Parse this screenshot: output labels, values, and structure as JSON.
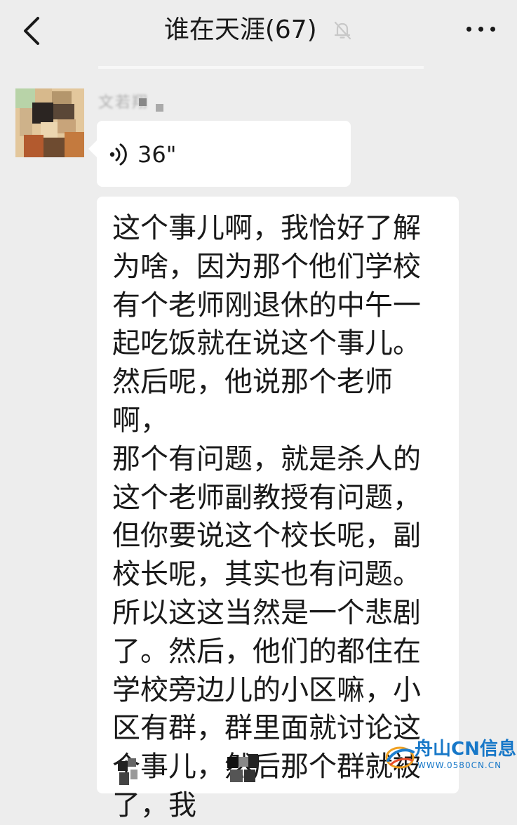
{
  "header": {
    "title": "谁在天涯(67)",
    "back_icon": "chevron-left-icon",
    "mute_icon": "bell-off-icon",
    "more_icon": "more-horizontal-icon"
  },
  "message": {
    "sender_name": "文若翔",
    "voice": {
      "icon": "voice-wave-icon",
      "duration": "36\""
    },
    "transcript": "这个事儿啊，我恰好了解\n为啥，因为那个他们学校\n有个老师刚退休的中午一\n起吃饭就在说这个事儿。\n然后呢，他说那个老师啊，\n那个有问题，就是杀人的\n这个老师副教授有问题，\n但你要说这个校长呢，副\n校长呢，其实也有问题。\n所以这这当然是一个悲剧\n了。然后，他们的都住在\n学校旁边儿的小区嘛，小\n区有群，群里面就讨论这\n个事儿，然后那个群就被\n  了，我"
  },
  "watermark": {
    "brand": "舟山CN信息网",
    "url": "WWW.0580CN.CN"
  },
  "colors": {
    "background": "#ededed",
    "bubble": "#ffffff",
    "text": "#191919",
    "watermark": "#1878c8"
  }
}
